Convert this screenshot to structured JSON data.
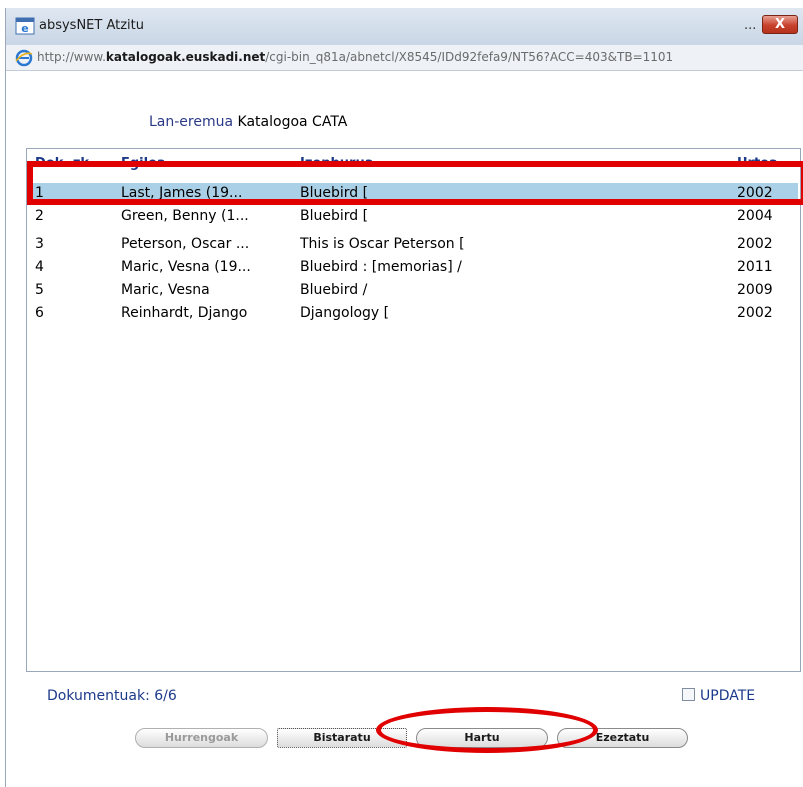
{
  "window": {
    "title": "absysNET Atzitu",
    "title_overflow": "...",
    "close_label": "X",
    "icon": "app-window-icon"
  },
  "address": {
    "url_prefix": "http://www.",
    "url_domain": "katalogoak.euskadi.net",
    "url_path": "/cgi-bin_q81a/abnetcl/X8545/IDd92fefa9/NT56?ACC=403&TB=1101",
    "icon": "ie-icon"
  },
  "header": {
    "label": "Lan-eremua",
    "catalog": "Katalogoa CATA"
  },
  "table": {
    "columns": [
      "Dok. zk.",
      "Egilea",
      "Izenburua",
      "Urtea"
    ],
    "rows": [
      {
        "num": "1",
        "author": "Last, James (19...",
        "title": "Bluebird [",
        "year": "2002"
      },
      {
        "num": "2",
        "author": "Green, Benny (1...",
        "title": "Bluebird [",
        "year": "2004"
      },
      {
        "num": "3",
        "author": "Peterson, Oscar ...",
        "title": "This is Oscar Peterson [",
        "year": "2002"
      },
      {
        "num": "4",
        "author": "Maric, Vesna (19...",
        "title": "Bluebird : [memorias] /",
        "year": "2011"
      },
      {
        "num": "5",
        "author": "Maric, Vesna",
        "title": "Bluebird /",
        "year": "2009"
      },
      {
        "num": "6",
        "author": "Reinhardt, Django",
        "title": "Djangology [",
        "year": "2002"
      }
    ],
    "selected_row": 0
  },
  "footer": {
    "status": "Dokumentuak: 6/6",
    "update_label": "UPDATE",
    "update_checked": false
  },
  "buttons": {
    "next": "Hurrengoak",
    "show": "Bistaratu",
    "take": "Hartu",
    "cancel": "Ezeztatu"
  },
  "colors": {
    "highlight": "#e00000",
    "selection": "#a9d0e6",
    "label_blue": "#1c3a8a"
  }
}
